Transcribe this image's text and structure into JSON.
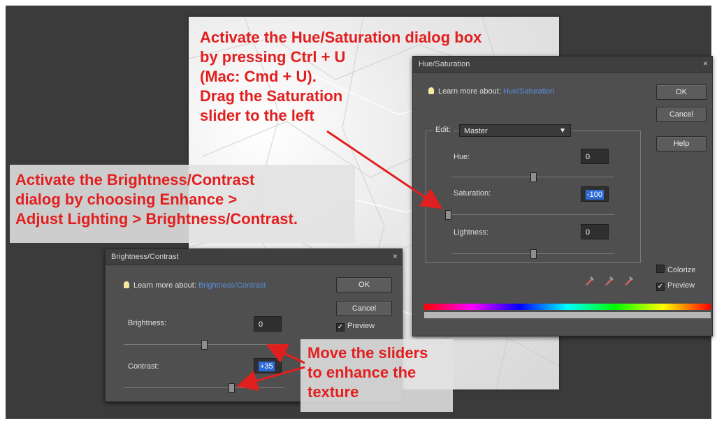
{
  "hue_dialog": {
    "title": "Hue/Saturation",
    "close": "×",
    "learn_label": "Learn more about:",
    "learn_link": "Hue/Saturation",
    "ok": "OK",
    "cancel": "Cancel",
    "help": "Help",
    "edit_label": "Edit:",
    "edit_value": "Master",
    "hue_label": "Hue:",
    "hue_value": "0",
    "saturation_label": "Saturation:",
    "saturation_value": "-100",
    "lightness_label": "Lightness:",
    "lightness_value": "0",
    "colorize_label": "Colorize",
    "colorize_checked": false,
    "preview_label": "Preview",
    "preview_checked": true,
    "hue_slider_level": 0.5,
    "saturation_slider_level": 0.0,
    "lightness_slider_level": 0.5
  },
  "bc_dialog": {
    "title": "Brightness/Contrast",
    "close": "×",
    "learn_label": "Learn more about:",
    "learn_link": "Brightness/Contrast",
    "ok": "OK",
    "cancel": "Cancel",
    "preview_label": "Preview",
    "preview_checked": true,
    "brightness_label": "Brightness:",
    "brightness_value": "0",
    "contrast_label": "Contrast:",
    "contrast_value": "+35",
    "brightness_slider_level": 0.5,
    "contrast_slider_level": 0.67
  },
  "annotations": {
    "hue_note": "Activate the Hue/Saturation dialog box\nby pressing Ctrl + U\n(Mac: Cmd + U).\nDrag the Saturation\nslider to the left",
    "bc_note": "Activate the Brightness/Contrast\ndialog by choosing Enhance >\nAdjust Lighting > Brightness/Contrast.",
    "slider_note": "Move the sliders\nto enhance the\ntexture"
  },
  "colors": {
    "annotation_red": "#e21f1f",
    "dialog_bg": "#4f4f4f",
    "link_blue": "#5a8fe0",
    "selection_blue": "#2e6bd6"
  }
}
